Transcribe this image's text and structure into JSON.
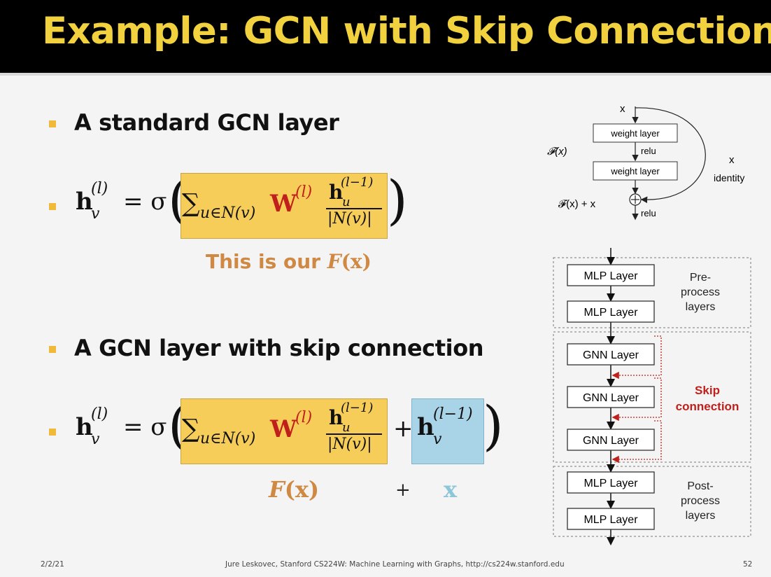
{
  "title": "Example: GCN with Skip  Connections",
  "section1": {
    "heading": "A standard GCN layer",
    "eq": {
      "h": "h",
      "h_sub": "v",
      "h_sup": "(l)",
      "eq": "= σ",
      "sum": "∑",
      "sum_sub": "u∈N(v)",
      "W": "W",
      "W_sup": "(l)",
      "num": "h",
      "num_sub": "u",
      "num_sup": "(l−1)",
      "den": "|N(v)|"
    },
    "caption_prefix": "This is our ",
    "caption_F": "F",
    "caption_x": "(x)"
  },
  "section2": {
    "heading": "A GCN layer with skip connection",
    "eq": {
      "h": "h",
      "h_sub": "v",
      "h_sup": "(l)",
      "eq": "= σ",
      "sum": "∑",
      "sum_sub": "u∈N(v)",
      "W": "W",
      "W_sup": "(l)",
      "num": "h",
      "num_sub": "u",
      "num_sup": "(l−1)",
      "den": "|N(v)|",
      "plus": "+",
      "skip_h": "h",
      "skip_sub": "v",
      "skip_sup": "(l−1)"
    },
    "caption_F": "F",
    "caption_x": "(x)",
    "caption_plus": "+",
    "caption_xx": "x"
  },
  "resnet_diagram": {
    "input": "x",
    "layer1": "weight layer",
    "relu1": "relu",
    "fx": "𝓕(x)",
    "layer2": "weight layer",
    "identity_x": "x",
    "identity": "identity",
    "sum_label": "𝓕(x) + x",
    "relu2": "relu",
    "plus_symbol": "⊕"
  },
  "arch_diagram": {
    "pre_layers": [
      "MLP Layer",
      "MLP Layer"
    ],
    "pre_label": [
      "Pre-",
      "process",
      "layers"
    ],
    "gnn_layers": [
      "GNN Layer",
      "GNN Layer",
      "GNN Layer"
    ],
    "skip_label": [
      "Skip",
      "connection"
    ],
    "post_layers": [
      "MLP Layer",
      "MLP Layer"
    ],
    "post_label": [
      "Post-",
      "process",
      "layers"
    ],
    "colors": {
      "skip": "#c0201b",
      "box_border": "#333333",
      "dashed": "#777777"
    }
  },
  "footer": {
    "date": "2/2/21",
    "credit": "Jure Leskovec, Stanford CS224W: Machine Learning with Graphs, http://cs224w.stanford.edu",
    "page": "52"
  },
  "colors": {
    "title": "#f2d13f",
    "bullet": "#f0b93a",
    "highlight_yellow": "#f7cd5a",
    "highlight_blue": "#a9d3e6",
    "orange_text": "#d08943",
    "teal_text": "#8cc6d8"
  }
}
